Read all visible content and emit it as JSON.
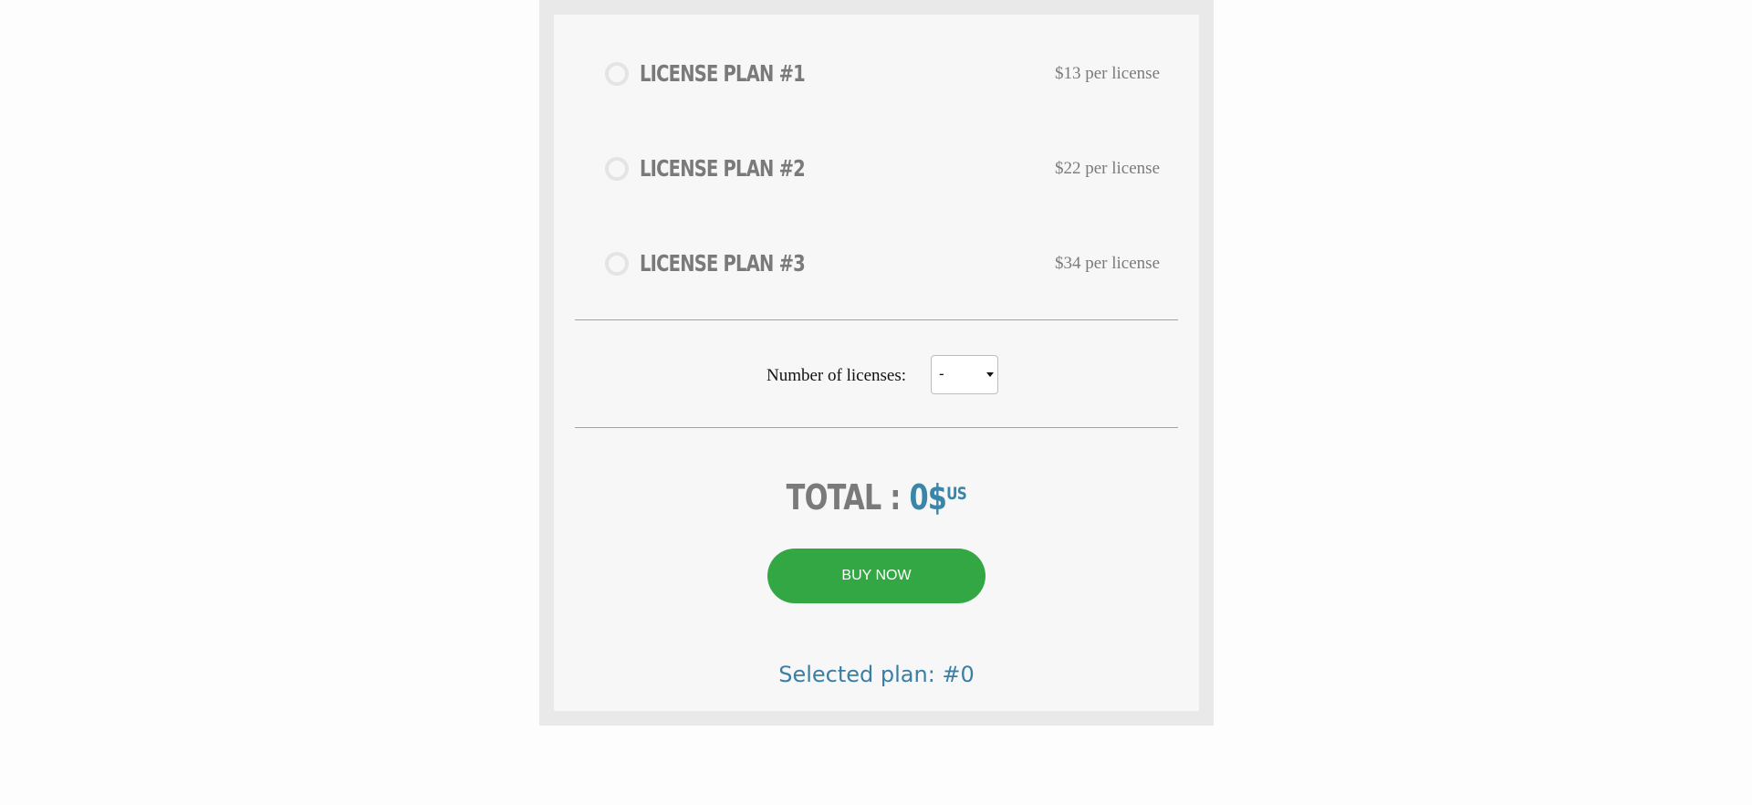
{
  "plans": [
    {
      "name": "LICENSE PLAN #1",
      "price": "$13 per license"
    },
    {
      "name": "LICENSE PLAN #2",
      "price": "$22 per license"
    },
    {
      "name": "LICENSE PLAN #3",
      "price": "$34 per license"
    }
  ],
  "licenses": {
    "label": "Number of licenses:",
    "selected": "-"
  },
  "total": {
    "label": "TOTAL : ",
    "amount": "0$",
    "currency": "US"
  },
  "buy_button": {
    "label": "BUY NOW"
  },
  "selected_plan": {
    "text": "Selected plan: #0"
  },
  "colors": {
    "accent_blue": "#3a86a8",
    "buy_green": "#34a745",
    "plan_gray": "#7a7a7a"
  }
}
